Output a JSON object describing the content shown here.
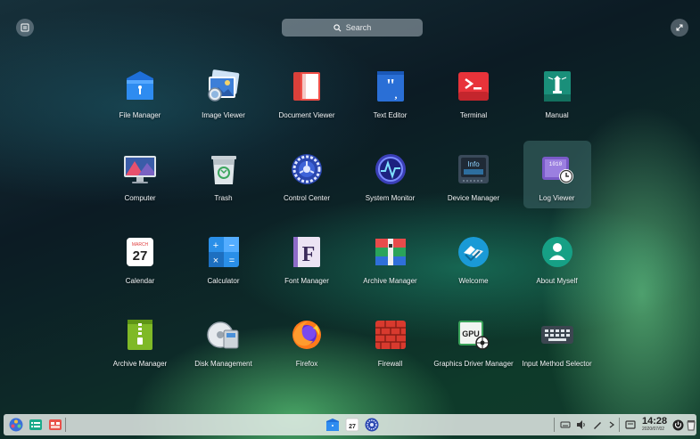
{
  "search": {
    "placeholder": "Search"
  },
  "apps": [
    {
      "label": "File Manager",
      "icon": "file-manager-icon"
    },
    {
      "label": "Image Viewer",
      "icon": "image-viewer-icon"
    },
    {
      "label": "Document Viewer",
      "icon": "document-viewer-icon"
    },
    {
      "label": "Text Editor",
      "icon": "text-editor-icon"
    },
    {
      "label": "Terminal",
      "icon": "terminal-icon"
    },
    {
      "label": "Manual",
      "icon": "manual-icon"
    },
    {
      "label": "Computer",
      "icon": "computer-icon"
    },
    {
      "label": "Trash",
      "icon": "trash-icon"
    },
    {
      "label": "Control Center",
      "icon": "control-center-icon"
    },
    {
      "label": "System Monitor",
      "icon": "system-monitor-icon"
    },
    {
      "label": "Device Manager",
      "icon": "device-manager-icon"
    },
    {
      "label": "Log Viewer",
      "icon": "log-viewer-icon",
      "selected": true
    },
    {
      "label": "Calendar",
      "icon": "calendar-icon"
    },
    {
      "label": "Calculator",
      "icon": "calculator-icon"
    },
    {
      "label": "Font Manager",
      "icon": "font-manager-icon"
    },
    {
      "label": "Archive Manager",
      "icon": "archive-manager-icon"
    },
    {
      "label": "Welcome",
      "icon": "welcome-icon"
    },
    {
      "label": "About Myself",
      "icon": "about-myself-icon"
    },
    {
      "label": "Archive Manager",
      "icon": "archive-manager-zip-icon"
    },
    {
      "label": "Disk Management",
      "icon": "disk-management-icon"
    },
    {
      "label": "Firefox",
      "icon": "firefox-icon"
    },
    {
      "label": "Firewall",
      "icon": "firewall-icon"
    },
    {
      "label": "Graphics Driver Manager",
      "icon": "graphics-driver-icon"
    },
    {
      "label": "Input Method Selector",
      "icon": "input-method-icon"
    }
  ],
  "icon_text": {
    "calendar_month": "MARCH",
    "calendar_day": "27",
    "font_letter": "F",
    "gpu": "GPU",
    "info": "Info",
    "log_digits": "1010"
  },
  "dock": {
    "calendar_day": "27",
    "time": "14:28",
    "date": "2020/07/02"
  }
}
